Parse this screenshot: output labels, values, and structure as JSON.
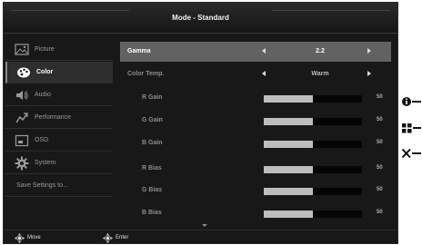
{
  "header": {
    "title": "Mode - Standard"
  },
  "sidebar": {
    "items": [
      {
        "label": "Picture",
        "icon": "picture-icon"
      },
      {
        "label": "Color",
        "icon": "palette-icon"
      },
      {
        "label": "Audio",
        "icon": "speaker-icon"
      },
      {
        "label": "Performance",
        "icon": "performance-icon"
      },
      {
        "label": "OSD",
        "icon": "osd-icon"
      },
      {
        "label": "System",
        "icon": "gear-icon"
      },
      {
        "label": "Save Settings to..."
      }
    ],
    "selected": "Color"
  },
  "panel": {
    "gamma": {
      "label": "Gamma",
      "value": "2.2"
    },
    "color_temp": {
      "label": "Color Temp.",
      "value": "Warm"
    },
    "sliders": [
      {
        "label": "R Gain",
        "value": "50",
        "level": 0.5
      },
      {
        "label": "G Gain",
        "value": "50",
        "level": 0.5
      },
      {
        "label": "B Gain",
        "value": "50",
        "level": 0.5
      },
      {
        "label": "R Bias",
        "value": "50",
        "level": 0.5
      },
      {
        "label": "G Bias",
        "value": "50",
        "level": 0.5
      },
      {
        "label": "B Bias",
        "value": "50",
        "level": 0.5
      }
    ]
  },
  "footer": {
    "move_label": "Move",
    "enter_label": "Enter"
  },
  "side_keys": [
    "info-icon",
    "menu-grid-icon",
    "close-icon"
  ],
  "colors": {
    "background": "#181818",
    "selected_row": "#626262",
    "slider_fill": "#bdbdbd"
  }
}
